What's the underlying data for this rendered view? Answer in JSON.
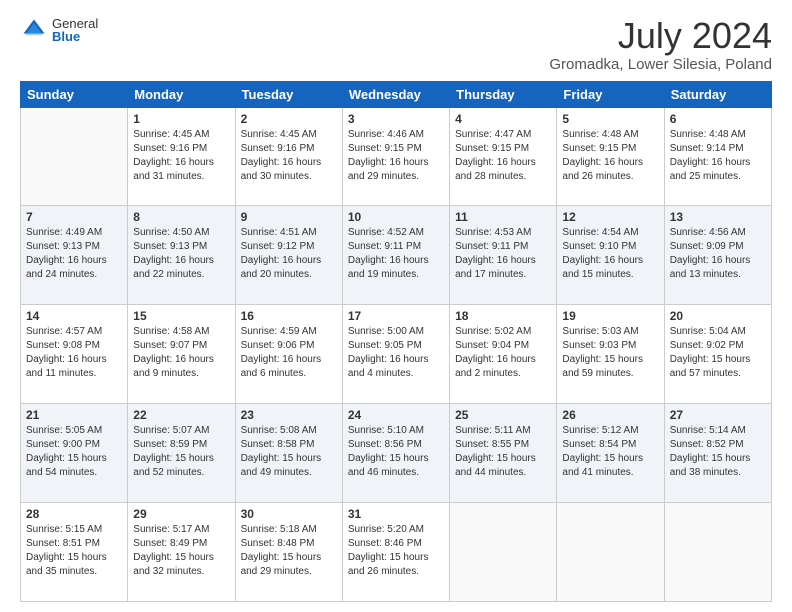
{
  "logo": {
    "general": "General",
    "blue": "Blue"
  },
  "title": "July 2024",
  "subtitle": "Gromadka, Lower Silesia, Poland",
  "days_header": [
    "Sunday",
    "Monday",
    "Tuesday",
    "Wednesday",
    "Thursday",
    "Friday",
    "Saturday"
  ],
  "weeks": [
    [
      {
        "day": "",
        "info": ""
      },
      {
        "day": "1",
        "info": "Sunrise: 4:45 AM\nSunset: 9:16 PM\nDaylight: 16 hours\nand 31 minutes."
      },
      {
        "day": "2",
        "info": "Sunrise: 4:45 AM\nSunset: 9:16 PM\nDaylight: 16 hours\nand 30 minutes."
      },
      {
        "day": "3",
        "info": "Sunrise: 4:46 AM\nSunset: 9:15 PM\nDaylight: 16 hours\nand 29 minutes."
      },
      {
        "day": "4",
        "info": "Sunrise: 4:47 AM\nSunset: 9:15 PM\nDaylight: 16 hours\nand 28 minutes."
      },
      {
        "day": "5",
        "info": "Sunrise: 4:48 AM\nSunset: 9:15 PM\nDaylight: 16 hours\nand 26 minutes."
      },
      {
        "day": "6",
        "info": "Sunrise: 4:48 AM\nSunset: 9:14 PM\nDaylight: 16 hours\nand 25 minutes."
      }
    ],
    [
      {
        "day": "7",
        "info": "Sunrise: 4:49 AM\nSunset: 9:13 PM\nDaylight: 16 hours\nand 24 minutes."
      },
      {
        "day": "8",
        "info": "Sunrise: 4:50 AM\nSunset: 9:13 PM\nDaylight: 16 hours\nand 22 minutes."
      },
      {
        "day": "9",
        "info": "Sunrise: 4:51 AM\nSunset: 9:12 PM\nDaylight: 16 hours\nand 20 minutes."
      },
      {
        "day": "10",
        "info": "Sunrise: 4:52 AM\nSunset: 9:11 PM\nDaylight: 16 hours\nand 19 minutes."
      },
      {
        "day": "11",
        "info": "Sunrise: 4:53 AM\nSunset: 9:11 PM\nDaylight: 16 hours\nand 17 minutes."
      },
      {
        "day": "12",
        "info": "Sunrise: 4:54 AM\nSunset: 9:10 PM\nDaylight: 16 hours\nand 15 minutes."
      },
      {
        "day": "13",
        "info": "Sunrise: 4:56 AM\nSunset: 9:09 PM\nDaylight: 16 hours\nand 13 minutes."
      }
    ],
    [
      {
        "day": "14",
        "info": "Sunrise: 4:57 AM\nSunset: 9:08 PM\nDaylight: 16 hours\nand 11 minutes."
      },
      {
        "day": "15",
        "info": "Sunrise: 4:58 AM\nSunset: 9:07 PM\nDaylight: 16 hours\nand 9 minutes."
      },
      {
        "day": "16",
        "info": "Sunrise: 4:59 AM\nSunset: 9:06 PM\nDaylight: 16 hours\nand 6 minutes."
      },
      {
        "day": "17",
        "info": "Sunrise: 5:00 AM\nSunset: 9:05 PM\nDaylight: 16 hours\nand 4 minutes."
      },
      {
        "day": "18",
        "info": "Sunrise: 5:02 AM\nSunset: 9:04 PM\nDaylight: 16 hours\nand 2 minutes."
      },
      {
        "day": "19",
        "info": "Sunrise: 5:03 AM\nSunset: 9:03 PM\nDaylight: 15 hours\nand 59 minutes."
      },
      {
        "day": "20",
        "info": "Sunrise: 5:04 AM\nSunset: 9:02 PM\nDaylight: 15 hours\nand 57 minutes."
      }
    ],
    [
      {
        "day": "21",
        "info": "Sunrise: 5:05 AM\nSunset: 9:00 PM\nDaylight: 15 hours\nand 54 minutes."
      },
      {
        "day": "22",
        "info": "Sunrise: 5:07 AM\nSunset: 8:59 PM\nDaylight: 15 hours\nand 52 minutes."
      },
      {
        "day": "23",
        "info": "Sunrise: 5:08 AM\nSunset: 8:58 PM\nDaylight: 15 hours\nand 49 minutes."
      },
      {
        "day": "24",
        "info": "Sunrise: 5:10 AM\nSunset: 8:56 PM\nDaylight: 15 hours\nand 46 minutes."
      },
      {
        "day": "25",
        "info": "Sunrise: 5:11 AM\nSunset: 8:55 PM\nDaylight: 15 hours\nand 44 minutes."
      },
      {
        "day": "26",
        "info": "Sunrise: 5:12 AM\nSunset: 8:54 PM\nDaylight: 15 hours\nand 41 minutes."
      },
      {
        "day": "27",
        "info": "Sunrise: 5:14 AM\nSunset: 8:52 PM\nDaylight: 15 hours\nand 38 minutes."
      }
    ],
    [
      {
        "day": "28",
        "info": "Sunrise: 5:15 AM\nSunset: 8:51 PM\nDaylight: 15 hours\nand 35 minutes."
      },
      {
        "day": "29",
        "info": "Sunrise: 5:17 AM\nSunset: 8:49 PM\nDaylight: 15 hours\nand 32 minutes."
      },
      {
        "day": "30",
        "info": "Sunrise: 5:18 AM\nSunset: 8:48 PM\nDaylight: 15 hours\nand 29 minutes."
      },
      {
        "day": "31",
        "info": "Sunrise: 5:20 AM\nSunset: 8:46 PM\nDaylight: 15 hours\nand 26 minutes."
      },
      {
        "day": "",
        "info": ""
      },
      {
        "day": "",
        "info": ""
      },
      {
        "day": "",
        "info": ""
      }
    ]
  ]
}
